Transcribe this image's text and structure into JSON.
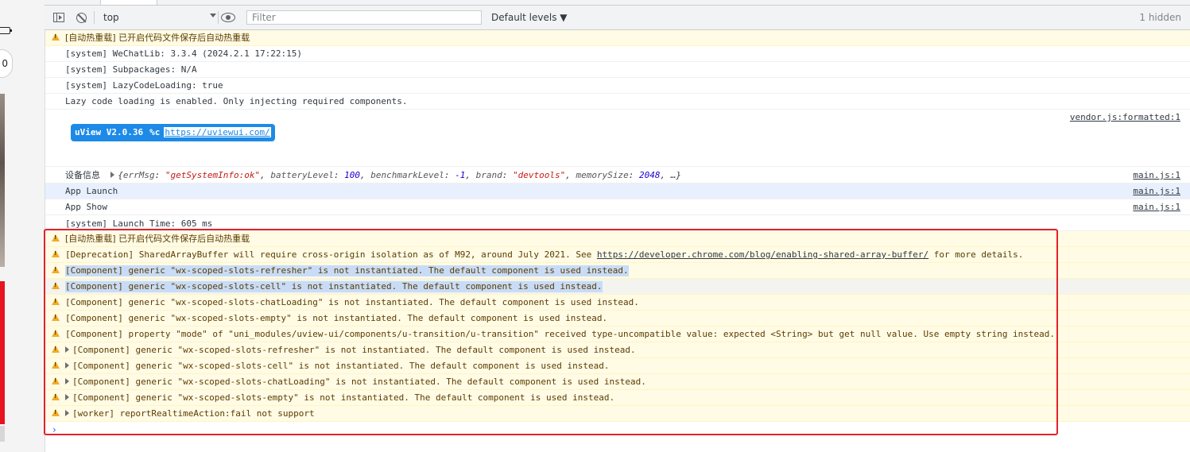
{
  "toolbar": {
    "context": "top",
    "filter_placeholder": "Filter",
    "levels": "Default levels ▼",
    "hidden": "1 hidden"
  },
  "simulator": {
    "pill_glyph": "0"
  },
  "messages": [
    {
      "text": "[自动热重载] 已开启代码文件保存后自动热重载"
    },
    {
      "text": "[system] WeChatLib: 3.3.4 (2024.2.1 17:22:15)"
    },
    {
      "text": "[system] Subpackages: N/A"
    },
    {
      "text": "[system] LazyCodeLoading: true"
    },
    {
      "text": "Lazy code loading is enabled. Only injecting required components."
    },
    {
      "source": "vendor.js:formatted:1",
      "badge_name": "uView V2.0.36",
      "badge_fmt": "%c",
      "badge_url": "https://uviewui.com/"
    },
    {
      "label": "设备信息",
      "obj": {
        "k1": "errMsg",
        "v1": "\"getSystemInfo:ok\"",
        "k2": "batteryLevel",
        "v2": "100",
        "k3": "benchmarkLevel",
        "v3": "-1",
        "k4": "brand",
        "v4": "\"devtools\"",
        "k5": "memorySize",
        "v5": "2048",
        "tail": ", …}"
      },
      "source": "main.js:1"
    },
    {
      "text": "App Launch",
      "source": "main.js:1"
    },
    {
      "text": "App Show",
      "source": "main.js:1"
    },
    {
      "text": "[system] Launch Time: 605 ms"
    },
    {
      "text": "[自动热重载] 已开启代码文件保存后自动热重载"
    },
    {
      "text_pre": "[Deprecation] SharedArrayBuffer will require cross-origin isolation as of M92, around July 2021. See ",
      "link": "https://developer.chrome.com/blog/enabling-shared-array-buffer/",
      "text_post": " for more details."
    },
    {
      "text": "[Component] generic \"wx-scoped-slots-refresher\" is not instantiated. The default component is used instead."
    },
    {
      "text": "[Component] generic \"wx-scoped-slots-cell\" is not instantiated. The default component is used instead."
    },
    {
      "text": "[Component] generic \"wx-scoped-slots-chatLoading\" is not instantiated. The default component is used instead."
    },
    {
      "text": "[Component] generic \"wx-scoped-slots-empty\" is not instantiated. The default component is used instead."
    },
    {
      "text": "[Component] property \"mode\" of \"uni_modules/uview-ui/components/u-transition/u-transition\" received type-uncompatible value: expected <String> but get null value. Use empty string instead."
    },
    {
      "text": "[Component] generic \"wx-scoped-slots-refresher\" is not instantiated. The default component is used instead."
    },
    {
      "text": "[Component] generic \"wx-scoped-slots-cell\" is not instantiated. The default component is used instead."
    },
    {
      "text": "[Component] generic \"wx-scoped-slots-chatLoading\" is not instantiated. The default component is used instead."
    },
    {
      "text": "[Component] generic \"wx-scoped-slots-empty\" is not instantiated. The default component is used instead."
    },
    {
      "text": "[worker] reportRealtimeAction:fail not support"
    }
  ],
  "prompt": "›",
  "colors": {
    "warning_bg": "#fffbe5",
    "warning_icon": "#f2ab26",
    "badge": "#1d8ae8",
    "highlight": "#c8dcf7",
    "annotation_box": "#e3222c"
  },
  "icons": [
    "sidebar-toggle-icon",
    "clear-console-icon",
    "dropdown-arrow-icon",
    "eye-icon",
    "warning-icon",
    "expand-triangle-icon",
    "prompt-chevron-icon"
  ]
}
